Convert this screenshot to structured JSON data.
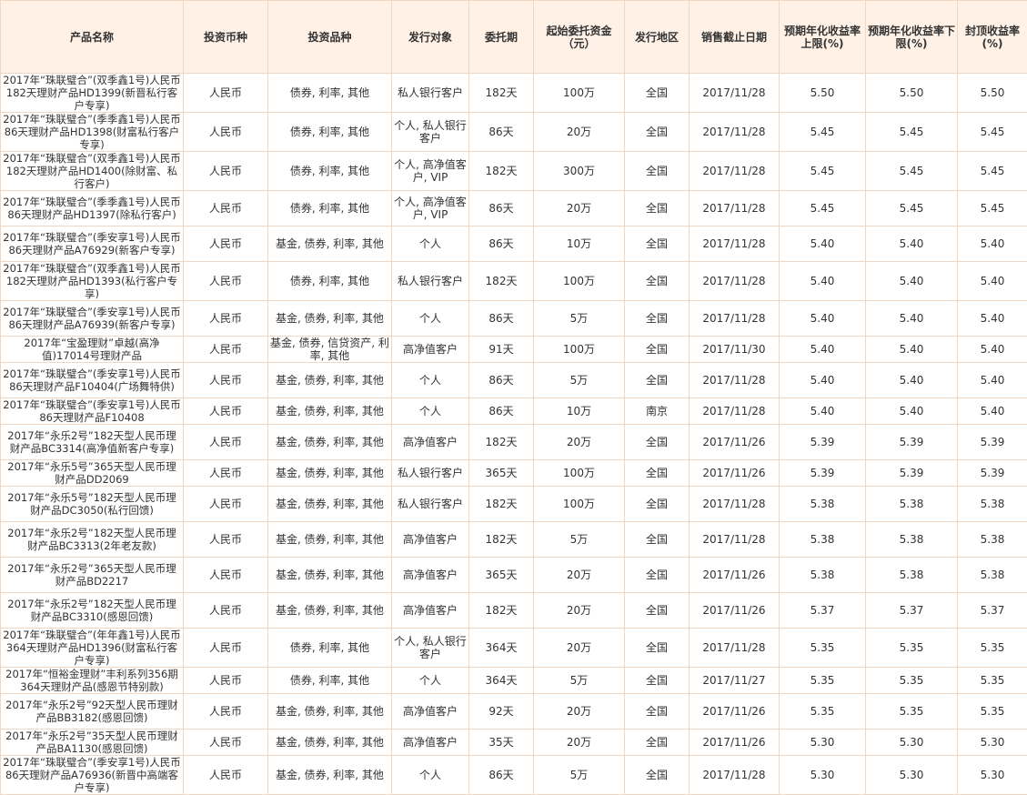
{
  "headers": [
    {
      "key": "name",
      "label": "产品名称"
    },
    {
      "key": "currency",
      "label": "投资币种"
    },
    {
      "key": "variety",
      "label": "投资品种"
    },
    {
      "key": "target",
      "label": "发行对象"
    },
    {
      "key": "term",
      "label": "委托期"
    },
    {
      "key": "min_investment",
      "label": "起始委托资金（元）"
    },
    {
      "key": "region",
      "label": "发行地区"
    },
    {
      "key": "deadline",
      "label": "销售截止日期"
    },
    {
      "key": "yield_upper",
      "label": "预期年化收益率上限(%)"
    },
    {
      "key": "yield_lower",
      "label": "预期年化收益率下限(%)"
    },
    {
      "key": "cap_yield",
      "label": "封顶收益率(%)"
    }
  ],
  "rows": [
    {
      "name": "2017年“珠联璧合”(双季鑫1号)人民币182天理财产品HD1399(新晋私行客户专享)",
      "currency": "人民币",
      "variety": "债券, 利率, 其他",
      "target": "私人银行客户",
      "term": "182天",
      "min_investment": "100万",
      "region": "全国",
      "deadline": "2017/11/28",
      "yield_upper": "5.50",
      "yield_lower": "5.50",
      "cap_yield": "5.50"
    },
    {
      "name": "2017年“珠联璧合”(季季鑫1号)人民币86天理财产品HD1398(财富私行客户专享)",
      "currency": "人民币",
      "variety": "债券, 利率, 其他",
      "target": "个人, 私人银行客户",
      "term": "86天",
      "min_investment": "20万",
      "region": "全国",
      "deadline": "2017/11/28",
      "yield_upper": "5.45",
      "yield_lower": "5.45",
      "cap_yield": "5.45"
    },
    {
      "name": "2017年“珠联璧合”(双季鑫1号)人民币182天理财产品HD1400(除财富、私行客户)",
      "currency": "人民币",
      "variety": "债券, 利率, 其他",
      "target": "个人, 高净值客户, VIP",
      "term": "182天",
      "min_investment": "300万",
      "region": "全国",
      "deadline": "2017/11/28",
      "yield_upper": "5.45",
      "yield_lower": "5.45",
      "cap_yield": "5.45"
    },
    {
      "name": "2017年“珠联璧合”(季季鑫1号)人民币86天理财产品HD1397(除私行客户)",
      "currency": "人民币",
      "variety": "债券, 利率, 其他",
      "target": "个人, 高净值客户, VIP",
      "term": "86天",
      "min_investment": "20万",
      "region": "全国",
      "deadline": "2017/11/28",
      "yield_upper": "5.45",
      "yield_lower": "5.45",
      "cap_yield": "5.45"
    },
    {
      "name": "2017年“珠联璧合”(季安享1号)人民币86天理财产品A76929(新客户专享)",
      "currency": "人民币",
      "variety": "基金, 债券, 利率, 其他",
      "target": "个人",
      "term": "86天",
      "min_investment": "10万",
      "region": "全国",
      "deadline": "2017/11/28",
      "yield_upper": "5.40",
      "yield_lower": "5.40",
      "cap_yield": "5.40"
    },
    {
      "name": "2017年“珠联璧合”(双季鑫1号)人民币182天理财产品HD1393(私行客户专享)",
      "currency": "人民币",
      "variety": "债券, 利率, 其他",
      "target": "私人银行客户",
      "term": "182天",
      "min_investment": "100万",
      "region": "全国",
      "deadline": "2017/11/28",
      "yield_upper": "5.40",
      "yield_lower": "5.40",
      "cap_yield": "5.40"
    },
    {
      "name": "2017年“珠联璧合”(季安享1号)人民币86天理财产品A76939(新客户专享)",
      "currency": "人民币",
      "variety": "基金, 债券, 利率, 其他",
      "target": "个人",
      "term": "86天",
      "min_investment": "5万",
      "region": "全国",
      "deadline": "2017/11/28",
      "yield_upper": "5.40",
      "yield_lower": "5.40",
      "cap_yield": "5.40"
    },
    {
      "name": "2017年“宝盈理财”卓越(高净值)17014号理财产品",
      "currency": "人民币",
      "variety": "基金, 债券, 信贷资产, 利率, 其他",
      "target": "高净值客户",
      "term": "91天",
      "min_investment": "100万",
      "region": "全国",
      "deadline": "2017/11/30",
      "yield_upper": "5.40",
      "yield_lower": "5.40",
      "cap_yield": "5.40"
    },
    {
      "name": "2017年“珠联璧合”(季安享1号)人民币86天理财产品F10404(广场舞特供)",
      "currency": "人民币",
      "variety": "基金, 债券, 利率, 其他",
      "target": "个人",
      "term": "86天",
      "min_investment": "5万",
      "region": "全国",
      "deadline": "2017/11/28",
      "yield_upper": "5.40",
      "yield_lower": "5.40",
      "cap_yield": "5.40"
    },
    {
      "name": "2017年“珠联璧合”(季安享1号)人民币86天理财产品F10408",
      "currency": "人民币",
      "variety": "基金, 债券, 利率, 其他",
      "target": "个人",
      "term": "86天",
      "min_investment": "10万",
      "region": "南京",
      "deadline": "2017/11/28",
      "yield_upper": "5.40",
      "yield_lower": "5.40",
      "cap_yield": "5.40"
    },
    {
      "name": "2017年“永乐2号”182天型人民币理财产品BC3314(高净值新客户专享)",
      "currency": "人民币",
      "variety": "基金, 债券, 利率, 其他",
      "target": "高净值客户",
      "term": "182天",
      "min_investment": "20万",
      "region": "全国",
      "deadline": "2017/11/26",
      "yield_upper": "5.39",
      "yield_lower": "5.39",
      "cap_yield": "5.39"
    },
    {
      "name": "2017年“永乐5号”365天型人民币理财产品DD2069",
      "currency": "人民币",
      "variety": "基金, 债券, 利率, 其他",
      "target": "私人银行客户",
      "term": "365天",
      "min_investment": "100万",
      "region": "全国",
      "deadline": "2017/11/26",
      "yield_upper": "5.39",
      "yield_lower": "5.39",
      "cap_yield": "5.39"
    },
    {
      "name": "2017年“永乐5号”182天型人民币理财产品DC3050(私行回馈)",
      "currency": "人民币",
      "variety": "基金, 债券, 利率, 其他",
      "target": "私人银行客户",
      "term": "182天",
      "min_investment": "100万",
      "region": "全国",
      "deadline": "2017/11/28",
      "yield_upper": "5.38",
      "yield_lower": "5.38",
      "cap_yield": "5.38"
    },
    {
      "name": "2017年“永乐2号”182天型人民币理财产品BC3313(2年老友款)",
      "currency": "人民币",
      "variety": "基金, 债券, 利率, 其他",
      "target": "高净值客户",
      "term": "182天",
      "min_investment": "5万",
      "region": "全国",
      "deadline": "2017/11/28",
      "yield_upper": "5.38",
      "yield_lower": "5.38",
      "cap_yield": "5.38"
    },
    {
      "name": "2017年“永乐2号”365天型人民币理财产品BD2217",
      "currency": "人民币",
      "variety": "基金, 债券, 利率, 其他",
      "target": "高净值客户",
      "term": "365天",
      "min_investment": "20万",
      "region": "全国",
      "deadline": "2017/11/26",
      "yield_upper": "5.38",
      "yield_lower": "5.38",
      "cap_yield": "5.38"
    },
    {
      "name": "2017年“永乐2号”182天型人民币理财产品BC3310(感恩回馈)",
      "currency": "人民币",
      "variety": "基金, 债券, 利率, 其他",
      "target": "高净值客户",
      "term": "182天",
      "min_investment": "20万",
      "region": "全国",
      "deadline": "2017/11/26",
      "yield_upper": "5.37",
      "yield_lower": "5.37",
      "cap_yield": "5.37"
    },
    {
      "name": "2017年“珠联璧合”(年年鑫1号)人民币364天理财产品HD1396(财富私行客户专享)",
      "currency": "人民币",
      "variety": "债券, 利率, 其他",
      "target": "个人, 私人银行客户",
      "term": "364天",
      "min_investment": "20万",
      "region": "全国",
      "deadline": "2017/11/28",
      "yield_upper": "5.35",
      "yield_lower": "5.35",
      "cap_yield": "5.35"
    },
    {
      "name": "2017年“恒裕金理财”丰利系列356期364天理财产品(感恩节特别款)",
      "currency": "人民币",
      "variety": "债券, 利率, 其他",
      "target": "个人",
      "term": "364天",
      "min_investment": "5万",
      "region": "全国",
      "deadline": "2017/11/27",
      "yield_upper": "5.35",
      "yield_lower": "5.35",
      "cap_yield": "5.35"
    },
    {
      "name": "2017年“永乐2号”92天型人民币理财产品BB3182(感恩回馈)",
      "currency": "人民币",
      "variety": "基金, 债券, 利率, 其他",
      "target": "高净值客户",
      "term": "92天",
      "min_investment": "20万",
      "region": "全国",
      "deadline": "2017/11/26",
      "yield_upper": "5.35",
      "yield_lower": "5.35",
      "cap_yield": "5.35"
    },
    {
      "name": "2017年“永乐2号”35天型人民币理财产品BA1130(感恩回馈)",
      "currency": "人民币",
      "variety": "基金, 债券, 利率, 其他",
      "target": "高净值客户",
      "term": "35天",
      "min_investment": "20万",
      "region": "全国",
      "deadline": "2017/11/26",
      "yield_upper": "5.30",
      "yield_lower": "5.30",
      "cap_yield": "5.30"
    },
    {
      "name": "2017年“珠联璧合”(季安享1号)人民币86天理财产品A76936(新晋中高端客户专享)",
      "currency": "人民币",
      "variety": "基金, 债券, 利率, 其他",
      "target": "个人",
      "term": "86天",
      "min_investment": "5万",
      "region": "全国",
      "deadline": "2017/11/28",
      "yield_upper": "5.30",
      "yield_lower": "5.30",
      "cap_yield": "5.30"
    }
  ]
}
